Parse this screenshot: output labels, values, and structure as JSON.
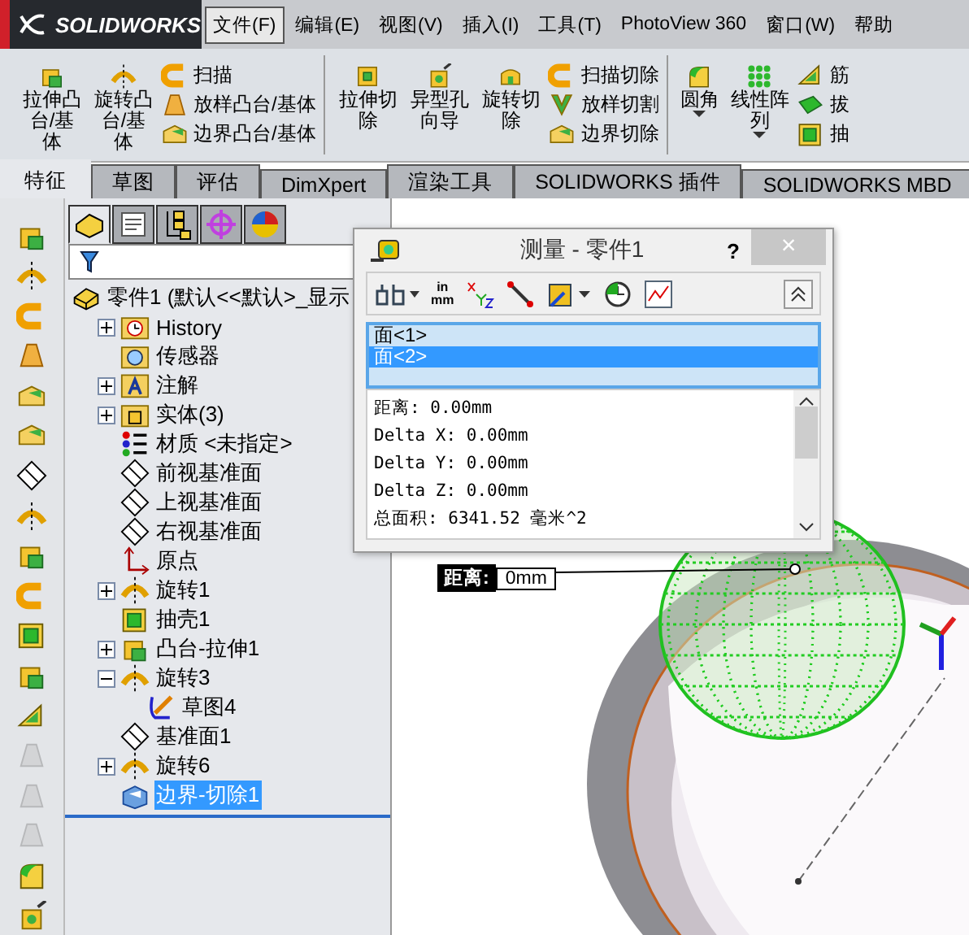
{
  "app": {
    "logo": "SOLIDWORKS"
  },
  "menu": [
    {
      "label": "文件(F)",
      "selected": true
    },
    {
      "label": "编辑(E)",
      "selected": false
    },
    {
      "label": "视图(V)",
      "selected": false
    },
    {
      "label": "插入(I)",
      "selected": false
    },
    {
      "label": "工具(T)",
      "selected": false
    },
    {
      "label": "PhotoView 360",
      "selected": false
    },
    {
      "label": "窗口(W)",
      "selected": false
    },
    {
      "label": "帮助",
      "selected": false
    }
  ],
  "ribbon": [
    {
      "large": [
        {
          "label": "拉伸凸台/基体",
          "kind": "extrude",
          "dropdown": false
        },
        {
          "label": "旋转凸台/基体",
          "kind": "revolve",
          "dropdown": false
        }
      ],
      "small": [
        {
          "label": "扫描",
          "kind": "sweep"
        },
        {
          "label": "放样凸台/基体",
          "kind": "loft"
        },
        {
          "label": "边界凸台/基体",
          "kind": "boundary"
        }
      ]
    },
    {
      "large": [
        {
          "label": "拉伸切除",
          "kind": "extrude-cut",
          "dropdown": false
        },
        {
          "label": "异型孔向导",
          "kind": "hole",
          "dropdown": false
        },
        {
          "label": "旋转切除",
          "kind": "revolve-cut",
          "dropdown": false
        }
      ],
      "small": [
        {
          "label": "扫描切除",
          "kind": "sweep"
        },
        {
          "label": "放样切割",
          "kind": "loft-cut"
        },
        {
          "label": "边界切除",
          "kind": "boundary"
        }
      ]
    },
    {
      "large": [
        {
          "label": "圆角",
          "kind": "fillet",
          "dropdown": true
        },
        {
          "label": "线性阵列",
          "kind": "pattern",
          "dropdown": true
        }
      ],
      "small": [
        {
          "label": "筋",
          "kind": "rib"
        },
        {
          "label": "拔",
          "kind": "draft"
        },
        {
          "label": "抽",
          "kind": "shell"
        }
      ]
    }
  ],
  "ribbon_tabs": [
    {
      "label": "特征",
      "selected": true
    },
    {
      "label": "草图",
      "selected": false
    },
    {
      "label": "评估",
      "selected": false
    },
    {
      "label": "DimXpert",
      "selected": false
    },
    {
      "label": "渲染工具",
      "selected": false
    },
    {
      "label": "SOLIDWORKS 插件",
      "selected": false
    },
    {
      "label": "SOLIDWORKS MBD",
      "selected": false
    }
  ],
  "left_toolbar": [
    {
      "kind": "extrude",
      "disabled": false
    },
    {
      "kind": "revolve",
      "disabled": false
    },
    {
      "kind": "sweep",
      "disabled": false
    },
    {
      "kind": "loft",
      "disabled": false
    },
    {
      "kind": "boundary",
      "disabled": false
    },
    {
      "kind": "boundary",
      "disabled": false
    },
    {
      "kind": "plane",
      "disabled": false
    },
    {
      "kind": "revolve",
      "disabled": false
    },
    {
      "kind": "extrude",
      "disabled": false
    },
    {
      "kind": "sweep",
      "disabled": false
    },
    {
      "kind": "shell",
      "disabled": false
    },
    {
      "kind": "extrude",
      "disabled": false
    },
    {
      "kind": "rib",
      "disabled": false
    },
    {
      "kind": "loft",
      "disabled": true
    },
    {
      "kind": "loft",
      "disabled": true
    },
    {
      "kind": "loft",
      "disabled": true
    },
    {
      "kind": "fillet",
      "disabled": false
    },
    {
      "kind": "hole",
      "disabled": false
    }
  ],
  "panel_tabs": [
    {
      "kind": "feature",
      "selected": true
    },
    {
      "kind": "property",
      "selected": false
    },
    {
      "kind": "config",
      "selected": false
    },
    {
      "kind": "target",
      "selected": false
    },
    {
      "kind": "display",
      "selected": false
    }
  ],
  "tree": {
    "label": "零件1  (默认<<默认>_显示",
    "kind": "part",
    "selected": false,
    "children": [
      {
        "label": "History",
        "kind": "history",
        "expanded": false,
        "selected": false
      },
      {
        "label": "传感器",
        "kind": "sensor",
        "selected": false
      },
      {
        "label": "注解",
        "kind": "annotation",
        "expanded": false,
        "selected": false
      },
      {
        "label": "实体(3)",
        "kind": "solid",
        "expanded": false,
        "selected": false
      },
      {
        "label": "材质 <未指定>",
        "kind": "material",
        "selected": false
      },
      {
        "label": "前视基准面",
        "kind": "plane",
        "selected": false
      },
      {
        "label": "上视基准面",
        "kind": "plane",
        "selected": false
      },
      {
        "label": "右视基准面",
        "kind": "plane",
        "selected": false
      },
      {
        "label": "原点",
        "kind": "origin",
        "selected": false
      },
      {
        "label": "旋转1",
        "kind": "revolve",
        "expanded": false,
        "selected": false
      },
      {
        "label": "抽壳1",
        "kind": "shell",
        "selected": false
      },
      {
        "label": "凸台-拉伸1",
        "kind": "extrude",
        "expanded": false,
        "selected": false
      },
      {
        "label": "旋转3",
        "kind": "revolve",
        "expanded": true,
        "selected": false,
        "children": [
          {
            "label": "草图4",
            "kind": "sketch",
            "selected": false
          }
        ]
      },
      {
        "label": "基准面1",
        "kind": "plane",
        "selected": false
      },
      {
        "label": "旋转6",
        "kind": "revolve",
        "expanded": false,
        "selected": false
      },
      {
        "label": "边界-切除1",
        "kind": "boundary-cut",
        "selected": true
      }
    ]
  },
  "measure": {
    "title": "测量 - 零件1",
    "help": "?",
    "close": "×",
    "units_top": "in",
    "units_bottom": "mm",
    "selections": [
      {
        "label": "面<1>",
        "selected": false
      },
      {
        "label": "面<2>",
        "selected": true
      }
    ],
    "results": [
      "距离: 0.00mm",
      "Delta X: 0.00mm",
      "Delta Y: 0.00mm",
      "Delta Z: 0.00mm",
      "总面积: 6341.52 毫米^2"
    ]
  },
  "callout": {
    "label": "距离:",
    "value": "0mm"
  }
}
